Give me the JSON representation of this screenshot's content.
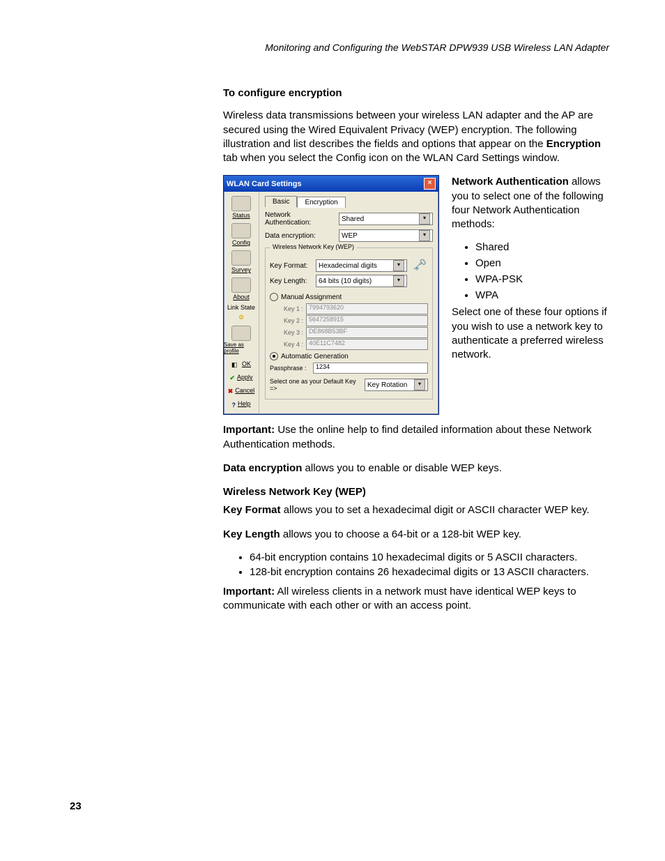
{
  "header": {
    "running": "Monitoring and Configuring the WebSTAR DPW939 USB Wireless LAN Adapter"
  },
  "section": {
    "title": "To configure encryption",
    "intro_a": "Wireless data transmissions between your wireless LAN adapter and the AP are secured using the Wired Equivalent Privacy (WEP) encryption. The following illustration and list describes the fields and options that appear on the ",
    "intro_bold": "Encryption",
    "intro_b": " tab when you select the Config icon on the WLAN Card Settings window."
  },
  "side": {
    "na_bold": "Network Authentication",
    "na_rest": " allows you to select one of the following four Network Authentication methods:",
    "methods": [
      "Shared",
      "Open",
      "WPA-PSK",
      "WPA"
    ],
    "na_after": "Select one of these four options if you wish to use a network key to authenticate a preferred wireless network."
  },
  "after": {
    "imp1_bold": "Important:",
    "imp1_rest": " Use the online help to find detailed information about these Network Authentication methods.",
    "de_bold": "Data encryption",
    "de_rest": " allows you to enable or disable WEP keys.",
    "wnk": "Wireless Network Key (WEP)",
    "kf_bold": "Key Format",
    "kf_rest": " allows you to set a hexadecimal digit or ASCII character WEP key.",
    "kl_bold": "Key Length",
    "kl_rest": " allows you to choose a 64-bit or a 128-bit WEP key.",
    "bits": [
      "64-bit encryption contains 10 hexadecimal digits or 5 ASCII characters.",
      "128-bit encryption contains 26 hexadecimal digits or 13 ASCII characters."
    ],
    "imp2_bold": "Important:",
    "imp2_rest": " All wireless clients in a network must have identical WEP keys to communicate with each other or with an access point."
  },
  "page_number": "23",
  "win": {
    "title": "WLAN Card Settings",
    "sidebar": {
      "status": "Status",
      "config": "Config",
      "survey": "Survey",
      "about": "About",
      "linkstate": "Link State",
      "saveprofile": "Save as profile",
      "ok": "OK",
      "apply": "Apply",
      "cancel": "Cancel",
      "help": "Help"
    },
    "tabs": {
      "basic": "Basic",
      "enc": "Encryption"
    },
    "fields": {
      "na_label": "Network Authentication:",
      "na_value": "Shared",
      "de_label": "Data encryption:",
      "de_value": "WEP",
      "group": "Wireless Network Key (WEP)",
      "kf_label": "Key Format:",
      "kf_value": "Hexadecimal digits",
      "kl_label": "Key Length:",
      "kl_value": "64 bits (10 digits)",
      "manual": "Manual Assignment",
      "k1l": "Key 1 :",
      "k1v": "7994793620",
      "k2l": "Key 2 :",
      "k2v": "5647258915",
      "k3l": "Key 3 :",
      "k3v": "DE868B53BF",
      "k4l": "Key 4 :",
      "k4v": "40E11C7482",
      "auto": "Automatic Generation",
      "pass_label": "Passphrase :",
      "pass_value": "1234",
      "default_label": "Select one as your Default Key =>",
      "default_value": "Key Rotation"
    }
  }
}
